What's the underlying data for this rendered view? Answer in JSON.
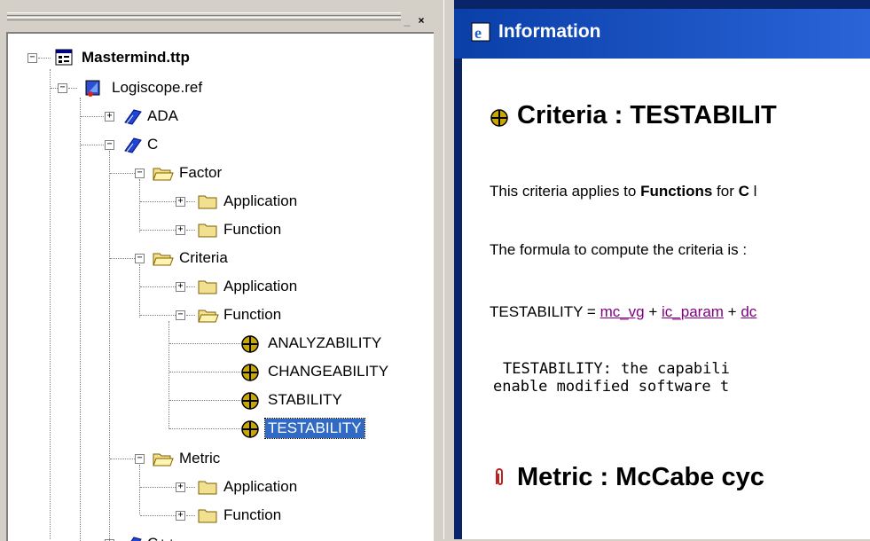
{
  "tree": {
    "root": "Mastermind.ttp",
    "ref": "Logiscope.ref",
    "langs": {
      "ada": "ADA",
      "c": "C",
      "cpp": "C++"
    },
    "factor": {
      "label": "Factor",
      "children": [
        "Application",
        "Function"
      ]
    },
    "criteria": {
      "label": "Criteria",
      "application": "Application",
      "function": "Function",
      "items": [
        "ANALYZABILITY",
        "CHANGEABILITY",
        "STABILITY",
        "TESTABILITY"
      ]
    },
    "metric": {
      "label": "Metric",
      "children": [
        "Application",
        "Function"
      ]
    },
    "selected": "TESTABILITY"
  },
  "pane_buttons": {
    "restore": "_",
    "close": "×"
  },
  "info": {
    "title": "Information",
    "heading": "Criteria : TESTABILIT",
    "applies_prefix": "This criteria applies to ",
    "applies_functions": "Functions",
    "applies_for": " for ",
    "applies_c": "C",
    "applies_suffix": " l",
    "formula_intro": "The formula to compute the criteria is :",
    "formula_lhs": "TESTABILITY = ",
    "formula_link1": "mc_vg",
    "formula_plus1": " + ",
    "formula_link2": "ic_param",
    "formula_plus2": " + ",
    "formula_link3": "dc",
    "desc_line1": "TESTABILITY: the capabili",
    "desc_line2": "enable modified software t",
    "metric_heading": "Metric : McCabe cyc"
  },
  "colors": {
    "selection": "#316ac5",
    "link": "#800080",
    "titlebar": "#0a3fa8"
  }
}
